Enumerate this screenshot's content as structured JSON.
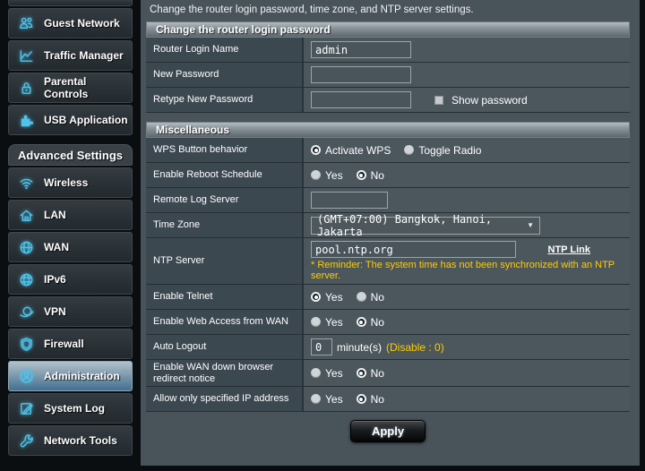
{
  "colors": {
    "accent": "#4fc3ea",
    "warning": "#ffcc00",
    "active_item": "#41708f"
  },
  "sidebar": {
    "general_items": [
      {
        "label": "Guest Network"
      },
      {
        "label": "Traffic Manager"
      },
      {
        "label": "Parental Controls"
      },
      {
        "label": "USB Application"
      }
    ],
    "section_title": "Advanced Settings",
    "advanced_items": [
      {
        "label": "Wireless"
      },
      {
        "label": "LAN"
      },
      {
        "label": "WAN"
      },
      {
        "label": "IPv6"
      },
      {
        "label": "VPN"
      },
      {
        "label": "Firewall"
      },
      {
        "label": "Administration",
        "active": true
      },
      {
        "label": "System Log"
      },
      {
        "label": "Network Tools"
      }
    ]
  },
  "main": {
    "description": "Change the router login password, time zone, and NTP server settings.",
    "password_section": {
      "title": "Change the router login password",
      "login_name": {
        "label": "Router Login Name",
        "value": "admin"
      },
      "new_password": {
        "label": "New Password",
        "value": ""
      },
      "retype_password": {
        "label": "Retype New Password",
        "value": "",
        "show_password_label": "Show password"
      }
    },
    "misc_section": {
      "title": "Miscellaneous",
      "wps": {
        "label": "WPS Button behavior",
        "option1": "Activate WPS",
        "option2": "Toggle Radio",
        "selected": "Activate WPS"
      },
      "reboot": {
        "label": "Enable Reboot Schedule",
        "yes": "Yes",
        "no": "No",
        "selected": "No"
      },
      "remote_log": {
        "label": "Remote Log Server",
        "value": ""
      },
      "time_zone": {
        "label": "Time Zone",
        "value": "(GMT+07:00) Bangkok, Hanoi, Jakarta"
      },
      "ntp": {
        "label": "NTP Server",
        "value": "pool.ntp.org",
        "link": "NTP Link",
        "reminder": "* Reminder: The system time has not been synchronized with an NTP server."
      },
      "telnet": {
        "label": "Enable Telnet",
        "yes": "Yes",
        "no": "No",
        "selected": "Yes"
      },
      "web_access": {
        "label": "Enable Web Access from WAN",
        "yes": "Yes",
        "no": "No",
        "selected": "No"
      },
      "auto_logout": {
        "label": "Auto Logout",
        "value": "0",
        "unit": "minute(s)",
        "hint": "(Disable : 0)"
      },
      "wan_down": {
        "label": "Enable WAN down browser redirect notice",
        "yes": "Yes",
        "no": "No",
        "selected": "No"
      },
      "allow_ip": {
        "label": "Allow only specified IP address",
        "yes": "Yes",
        "no": "No",
        "selected": "No"
      }
    },
    "apply_label": "Apply"
  }
}
